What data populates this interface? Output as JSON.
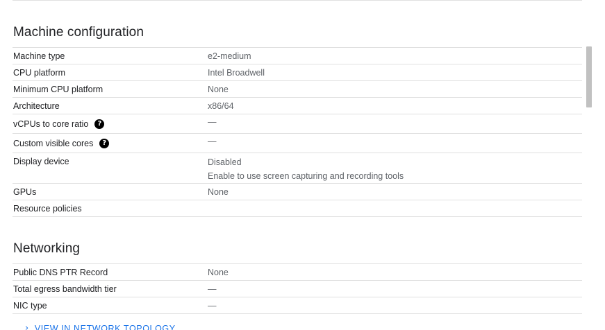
{
  "machine_configuration": {
    "title": "Machine configuration",
    "rows": [
      {
        "label": "Machine type",
        "value": "e2-medium"
      },
      {
        "label": "CPU platform",
        "value": "Intel Broadwell"
      },
      {
        "label": "Minimum CPU platform",
        "value": "None"
      },
      {
        "label": "Architecture",
        "value": "x86/64"
      },
      {
        "label": "vCPUs to core ratio",
        "value": "—"
      },
      {
        "label": "Custom visible cores",
        "value": "—"
      },
      {
        "label": "Display device",
        "value": "Disabled",
        "subtext": "Enable to use screen capturing and recording tools"
      },
      {
        "label": "GPUs",
        "value": "None"
      },
      {
        "label": "Resource policies",
        "value": ""
      }
    ],
    "help_glyph": "?"
  },
  "networking": {
    "title": "Networking",
    "rows": [
      {
        "label": "Public DNS PTR Record",
        "value": "None"
      },
      {
        "label": "Total egress bandwidth tier",
        "value": "—"
      },
      {
        "label": "NIC type",
        "value": "—"
      }
    ],
    "topology_link": "VIEW IN NETWORK TOPOLOGY"
  },
  "colors": {
    "link": "#1a73e8",
    "value_text": "#5f6368",
    "divider": "#e0e0e0"
  }
}
